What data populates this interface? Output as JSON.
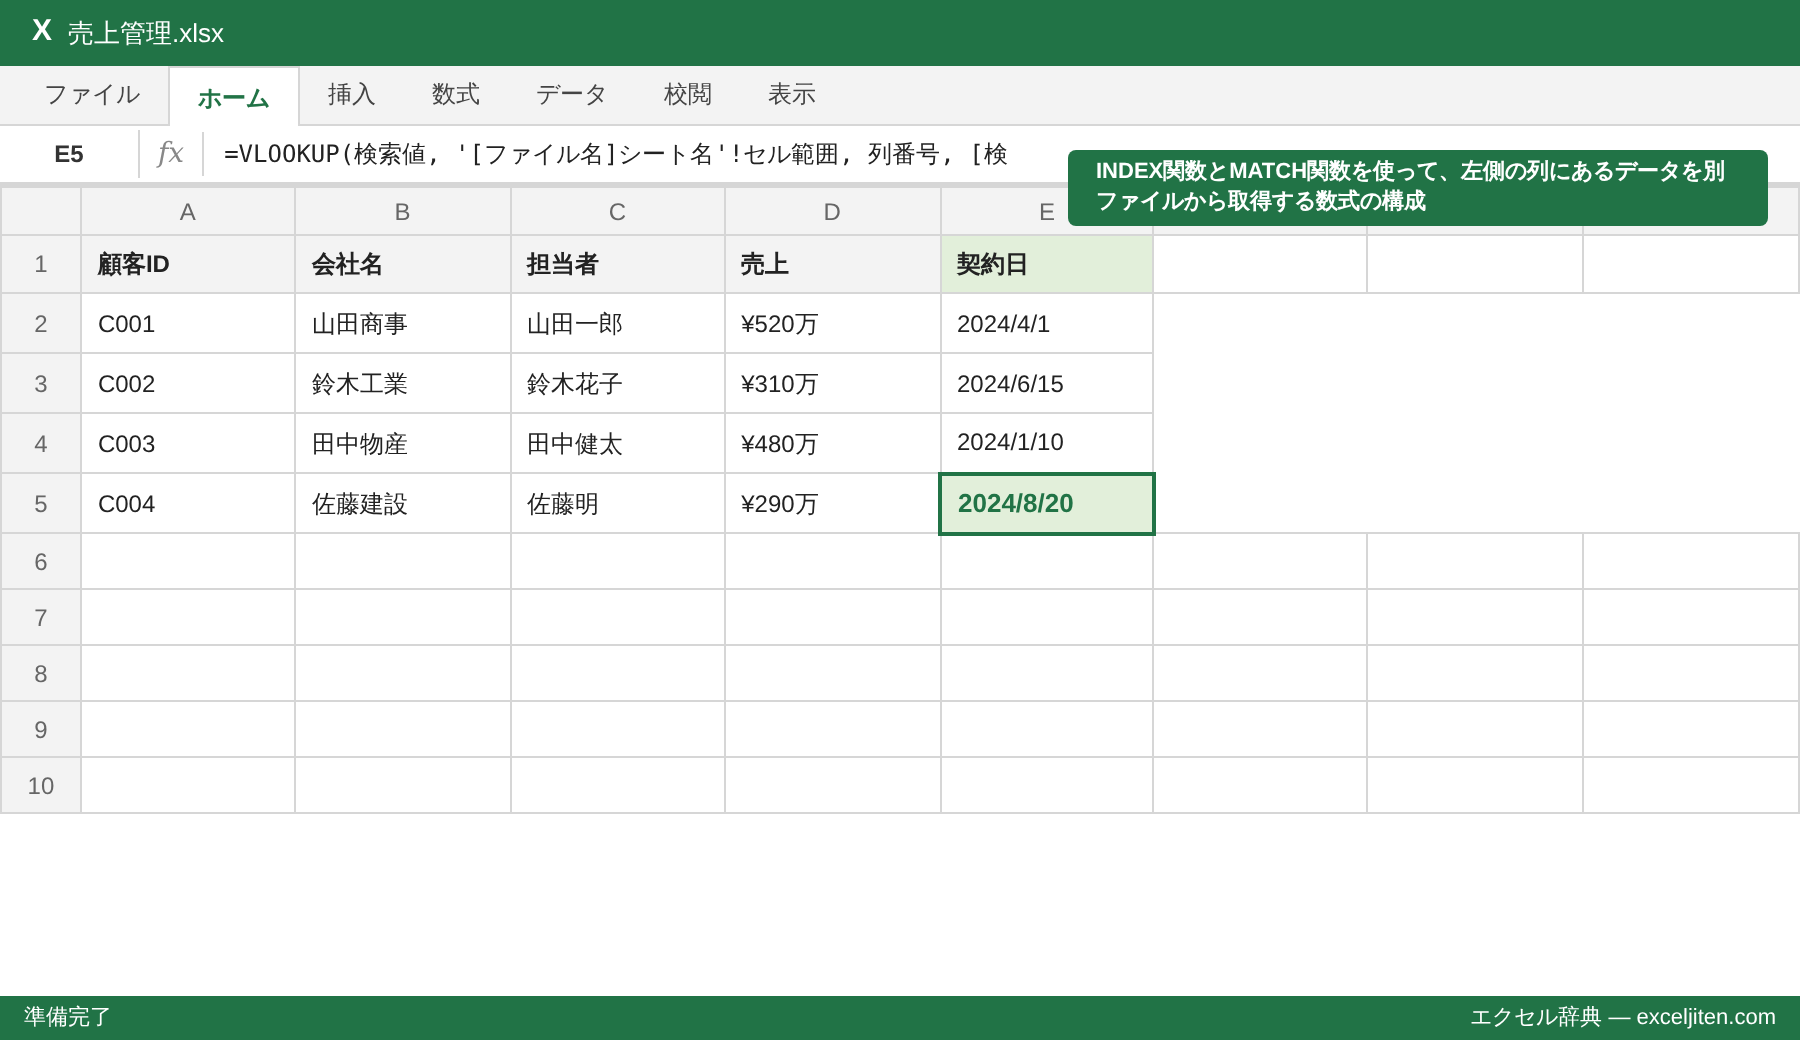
{
  "window": {
    "app_icon": "X",
    "title": "売上管理.xlsx"
  },
  "tabs": [
    {
      "label": "ファイル",
      "selected": false
    },
    {
      "label": "ホーム",
      "selected": true
    },
    {
      "label": "挿入",
      "selected": false
    },
    {
      "label": "数式",
      "selected": false
    },
    {
      "label": "データ",
      "selected": false
    },
    {
      "label": "校閲",
      "selected": false
    },
    {
      "label": "表示",
      "selected": false
    }
  ],
  "formula_bar": {
    "name_box": "E5",
    "fx": "fx",
    "formula": "=VLOOKUP(検索値, '[ファイル名]シート名'!セル範囲, 列番号, [検"
  },
  "tooltip": {
    "text": "INDEX関数とMATCH関数を使って、左側の列にあるデータを別ファイルから取得する数式の構成"
  },
  "sheet": {
    "columns": [
      "A",
      "B",
      "C",
      "D",
      "E"
    ],
    "rows": [
      {
        "number": "1",
        "kind": "header",
        "cells": [
          {
            "text": "顧客ID",
            "highlighted": false
          },
          {
            "text": "会社名",
            "highlighted": false
          },
          {
            "text": "担当者",
            "highlighted": false
          },
          {
            "text": "売上",
            "highlighted": false
          },
          {
            "text": "契約日",
            "highlighted": true
          }
        ]
      },
      {
        "number": "2",
        "kind": "data",
        "cells": [
          {
            "text": "C001",
            "selected": false
          },
          {
            "text": "山田商事",
            "selected": false
          },
          {
            "text": "山田一郎",
            "selected": false
          },
          {
            "text": "¥520万",
            "selected": false
          },
          {
            "text": "2024/4/1",
            "selected": false
          }
        ]
      },
      {
        "number": "3",
        "kind": "data",
        "cells": [
          {
            "text": "C002",
            "selected": false
          },
          {
            "text": "鈴木工業",
            "selected": false
          },
          {
            "text": "鈴木花子",
            "selected": false
          },
          {
            "text": "¥310万",
            "selected": false
          },
          {
            "text": "2024/6/15",
            "selected": false
          }
        ]
      },
      {
        "number": "4",
        "kind": "data",
        "cells": [
          {
            "text": "C003",
            "selected": false
          },
          {
            "text": "田中物産",
            "selected": false
          },
          {
            "text": "田中健太",
            "selected": false
          },
          {
            "text": "¥480万",
            "selected": false
          },
          {
            "text": "2024/1/10",
            "selected": false
          }
        ]
      },
      {
        "number": "5",
        "kind": "data",
        "cells": [
          {
            "text": "C004",
            "selected": false
          },
          {
            "text": "佐藤建設",
            "selected": false
          },
          {
            "text": "佐藤明",
            "selected": false
          },
          {
            "text": "¥290万",
            "selected": false
          },
          {
            "text": "2024/8/20",
            "selected": true
          }
        ]
      },
      {
        "number": "6",
        "kind": "empty"
      },
      {
        "number": "7",
        "kind": "empty"
      },
      {
        "number": "8",
        "kind": "empty"
      },
      {
        "number": "9",
        "kind": "empty"
      },
      {
        "number": "10",
        "kind": "empty"
      }
    ]
  },
  "status_bar": {
    "left": "準備完了",
    "right": "エクセル辞典 — exceljiten.com"
  }
}
